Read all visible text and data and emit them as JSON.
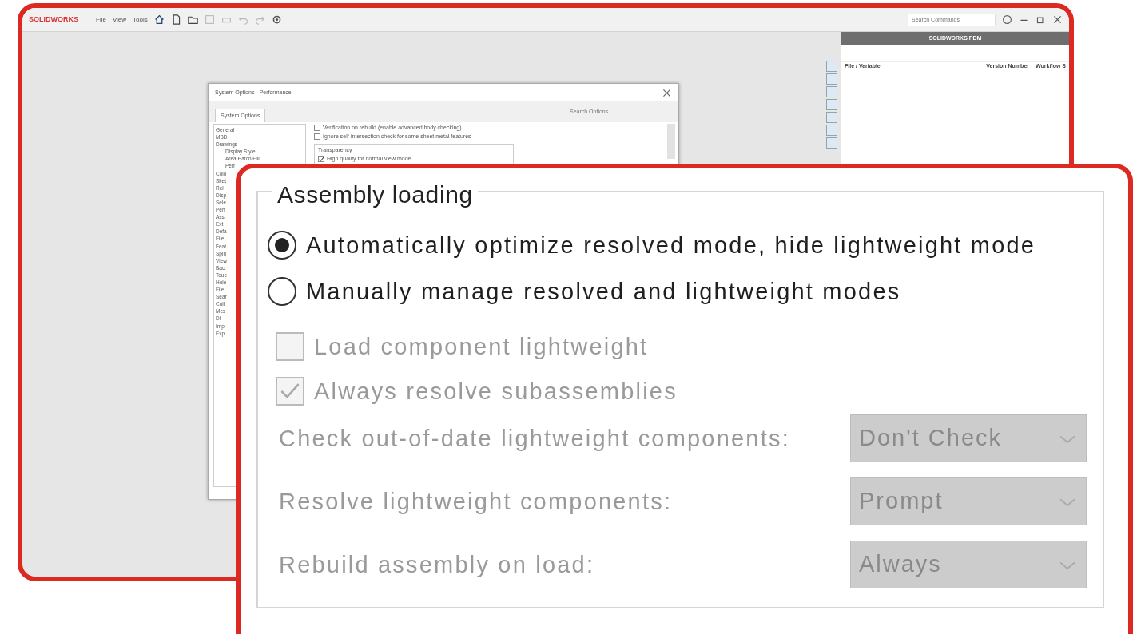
{
  "app_window": {
    "logo": "SOLIDWORKS",
    "menus": [
      "File",
      "View",
      "Tools"
    ],
    "search": {
      "placeholder": "Search Commands"
    },
    "dialog": {
      "title": "System Options - Performance",
      "tabs": [
        {
          "label": "System Options",
          "selected": true
        }
      ],
      "search": {
        "placeholder": "Search Options"
      },
      "tree": [
        "General",
        "MBD",
        "Drawings",
        "Display Style",
        "Area Hatch/Fill",
        "Perf",
        "Colo",
        "Sket",
        "Rel",
        "Disp",
        "Sele",
        "Perf",
        "Ass",
        "Ext",
        "Defa",
        "File",
        "Feat",
        "Spin",
        "View",
        "Bac",
        "Touc",
        "Hole",
        "File",
        "Sear",
        "Coll",
        "Mes",
        "Di",
        "Imp",
        "Exp"
      ],
      "options": [
        {
          "label": "Verification on rebuild (enable advanced body checking)",
          "checked": false
        },
        {
          "label": "Ignore self-intersection check for some sheet metal features",
          "checked": false
        }
      ],
      "group": {
        "legend": "Transparency",
        "options": [
          {
            "label": "High quality for normal view mode",
            "checked": true
          }
        ]
      }
    },
    "pdm_panel": {
      "title": "SOLIDWORKS PDM",
      "columns": [
        "File / Variable",
        "Version Number",
        "Workflow S"
      ]
    }
  },
  "callout": {
    "legend": "Assembly loading",
    "radios": [
      {
        "label": "Automatically optimize resolved mode, hide lightweight mode",
        "selected": true
      },
      {
        "label": "Manually manage resolved and lightweight modes",
        "selected": false
      }
    ],
    "checkboxes": [
      {
        "label": "Load component lightweight",
        "checked": false,
        "disabled": true
      },
      {
        "label": "Always resolve subassemblies",
        "checked": true,
        "disabled": true
      }
    ],
    "rows": [
      {
        "label": "Check out-of-date lightweight components:",
        "value": "Don't Check",
        "disabled": true
      },
      {
        "label": "Resolve lightweight components:",
        "value": "Prompt",
        "disabled": true
      },
      {
        "label": "Rebuild assembly on load:",
        "value": "Always",
        "disabled": true
      }
    ]
  }
}
